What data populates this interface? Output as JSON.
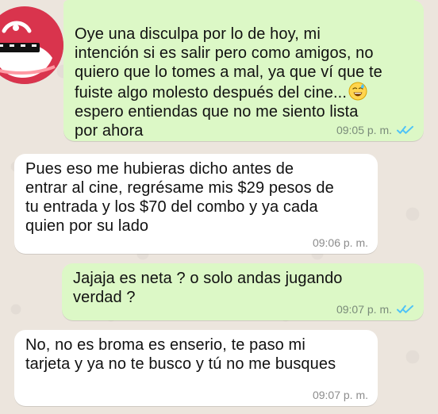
{
  "messages": [
    {
      "text": "Oye una disculpa por lo de hoy, mi\nintención si es salir pero como amigos, no\nquiero que lo tomes a mal, ya que ví que te\nfuiste algo molesto después del cine...",
      "text_after_emoji": "\nespero entiendas que no me siento lista\npor ahora",
      "time": "09:05 p. m.",
      "emoji_icon": "sweat-smile-emoji-icon"
    },
    {
      "text": "Pues eso me hubieras dicho antes de\nentrar al cine, regrésame mis $29 pesos de\ntu entrada y los $70 del combo y ya cada\nquien por su lado",
      "time": "09:06 p. m."
    },
    {
      "text": "Jajaja es neta ? o solo andas jugando\nverdad ?",
      "time": "09:07 p. m."
    },
    {
      "text": "No, no es broma es enserio, te paso mi\ntarjeta y ya no te busco y tú no me busques",
      "time": "09:07 p. m."
    }
  ],
  "theme": {
    "chat_bg": "#ece5dd",
    "outgoing_bubble": "#dcf8c6",
    "incoming_bubble": "#ffffff",
    "read_ticks": "#4fc3f7",
    "avatar_color": "#e13f55"
  }
}
